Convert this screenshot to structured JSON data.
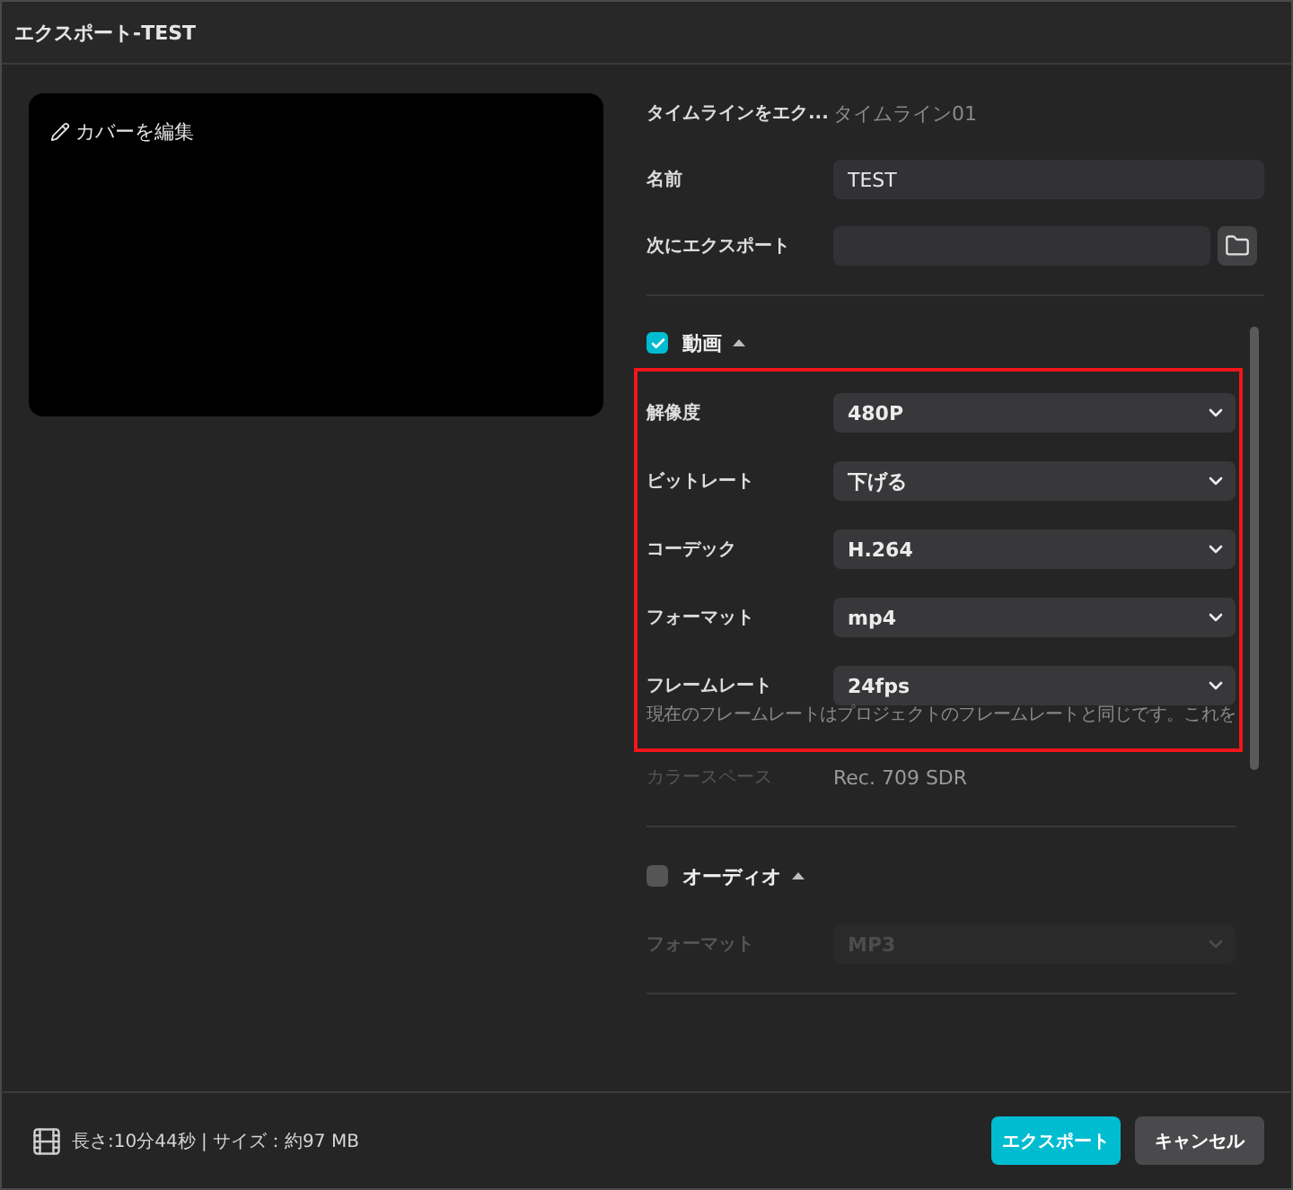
{
  "window": {
    "title": "エクスポート-TEST"
  },
  "cover": {
    "edit_label": "カバーを編集"
  },
  "fields": [
    {
      "kind": "text",
      "label": "タイムラインをエク...",
      "value": "タイムライン01"
    },
    {
      "kind": "input",
      "label": "名前",
      "value": "TEST"
    },
    {
      "kind": "path",
      "label": "次にエクスポート"
    }
  ],
  "sections": [
    {
      "title": "動画",
      "checked": true,
      "expanded": true,
      "groups": [
        {
          "highlighted": true,
          "items": [
            {
              "kind": "select",
              "label": "解像度",
              "value": "480P",
              "disabled": false
            },
            {
              "kind": "select",
              "label": "ビットレート",
              "value": "下げる",
              "disabled": false
            },
            {
              "kind": "select",
              "label": "コーデック",
              "value": "H.264",
              "disabled": false
            },
            {
              "kind": "select",
              "label": "フォーマット",
              "value": "mp4",
              "disabled": false
            },
            {
              "kind": "select",
              "label": "フレームレート",
              "value": "24fps",
              "disabled": false
            },
            {
              "kind": "hint",
              "text": "現在のフレームレートはプロジェクトのフレームレートと同じです。これを"
            }
          ]
        },
        {
          "highlighted": false,
          "items": [
            {
              "kind": "info",
              "label": "カラースペース",
              "value": "Rec. 709 SDR"
            }
          ]
        }
      ]
    },
    {
      "title": "オーディオ",
      "checked": false,
      "expanded": true,
      "groups": [
        {
          "highlighted": false,
          "items": [
            {
              "kind": "select",
              "label": "フォーマット",
              "value": "MP3",
              "disabled": true
            }
          ]
        }
      ]
    }
  ],
  "footer": {
    "summary": "長さ:10分44秒 | サイズ：約97 MB",
    "buttons": [
      {
        "kind": "primary",
        "label": "エクスポート"
      },
      {
        "kind": "secondary",
        "label": "キャンセル"
      }
    ]
  }
}
